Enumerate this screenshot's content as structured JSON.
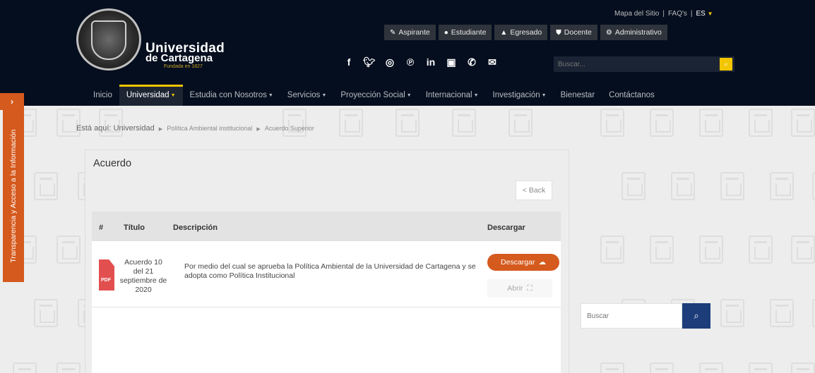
{
  "header": {
    "brand_line1": "Universidad",
    "brand_line2": "de Cartagena",
    "brand_line3": "Fundada en 1827",
    "top_links": [
      "Mapa del Sitio",
      "FAQ's"
    ],
    "language": "ES",
    "roles": [
      {
        "label": "Aspirante",
        "icon": "edit-icon"
      },
      {
        "label": "Estudiante",
        "icon": "user-icon"
      },
      {
        "label": "Egresado",
        "icon": "graduation-cap-icon"
      },
      {
        "label": "Docente",
        "icon": "shield-icon"
      },
      {
        "label": "Administrativo",
        "icon": "gear-icon"
      }
    ],
    "socials": [
      "facebook-icon",
      "twitter-icon",
      "instagram-icon",
      "pinterest-icon",
      "linkedin-icon",
      "youtube-icon",
      "whatsapp-icon",
      "email-icon"
    ],
    "search_placeholder": "Buscar..."
  },
  "nav": {
    "items": [
      {
        "label": "Inicio",
        "dropdown": false
      },
      {
        "label": "Universidad",
        "dropdown": true,
        "active": true
      },
      {
        "label": "Estudia con Nosotros",
        "dropdown": true
      },
      {
        "label": "Servicios",
        "dropdown": true
      },
      {
        "label": "Proyección Social",
        "dropdown": true
      },
      {
        "label": "Internacional",
        "dropdown": true
      },
      {
        "label": "Investigación",
        "dropdown": true
      },
      {
        "label": "Bienestar",
        "dropdown": false
      },
      {
        "label": "Contáctanos",
        "dropdown": false
      }
    ]
  },
  "side_tab": {
    "label": "Transparencia y Acceso a la Información",
    "arrow": "›"
  },
  "breadcrumb": {
    "prefix": "Está aquí:",
    "items": [
      "Universidad",
      "Política Ambiental institucional",
      "Acuerdo Superior"
    ]
  },
  "panel": {
    "title": "Acuerdo",
    "back_label": "< Back",
    "table": {
      "headers": [
        "#",
        "Título",
        "Descripción",
        "Descargar"
      ],
      "rows": [
        {
          "icon_text": "PDF",
          "title": "Acuerdo 10 del 21 septiembre de 2020",
          "description": "Por medio del cual se aprueba la Política Ambiental de la Universidad de Cartagena y se adopta como Política Institucional",
          "download_label": "Descargar",
          "open_label": "Abrir"
        }
      ]
    }
  },
  "sidebar_search": {
    "placeholder": "Buscar"
  },
  "colors": {
    "header_bg": "#050e1e",
    "accent_gold": "#f2c500",
    "accent_orange": "#d55a1d",
    "search_blue": "#1c3d7a"
  }
}
